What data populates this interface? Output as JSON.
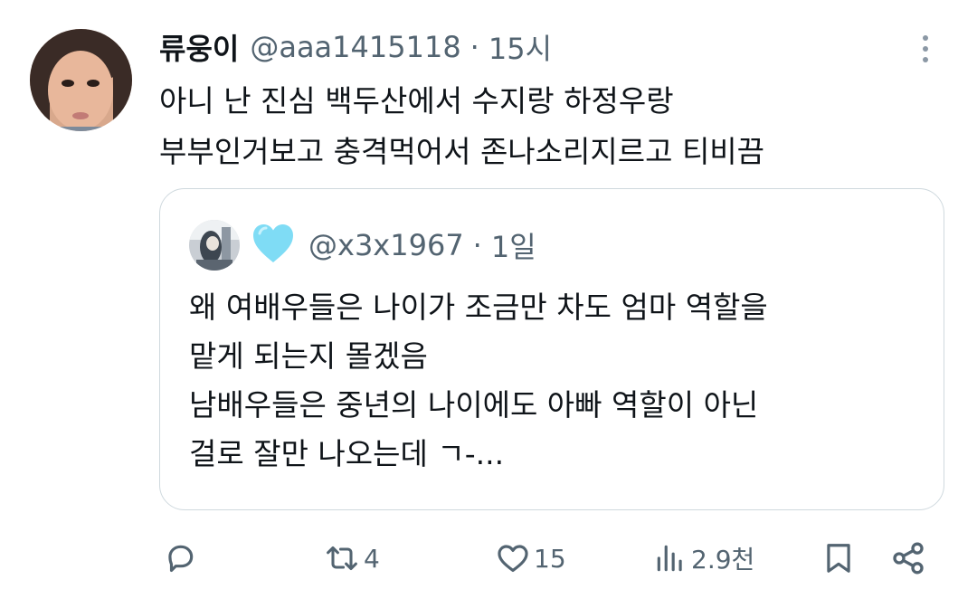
{
  "tweet": {
    "display_name": "류웅이",
    "handle": "@aaa1415118",
    "separator": "·",
    "time": "15시",
    "text_lines": [
      "아니 난 진심 백두산에서 수지랑 하정우랑",
      "부부인거보고 충격먹어서 존나소리지르고 티비끔"
    ]
  },
  "quote": {
    "badge_icon": "blue-heart",
    "handle": "@x3x1967",
    "separator": "·",
    "time": "1일",
    "text_lines": [
      "왜 여배우들은 나이가 조금만 차도 엄마 역할을",
      "맡게 되는지 몰겠음",
      "남배우들은 중년의 나이에도 아빠 역할이 아닌",
      "걸로 잘만 나오는데 ㄱ-..."
    ]
  },
  "actions": {
    "reply_count": "",
    "retweet_count": "4",
    "like_count": "15",
    "views_count": "2.9천"
  },
  "colors": {
    "text": "#0f1419",
    "secondary": "#536471",
    "border": "#cfd9de",
    "heart": "#7fdcf5"
  }
}
